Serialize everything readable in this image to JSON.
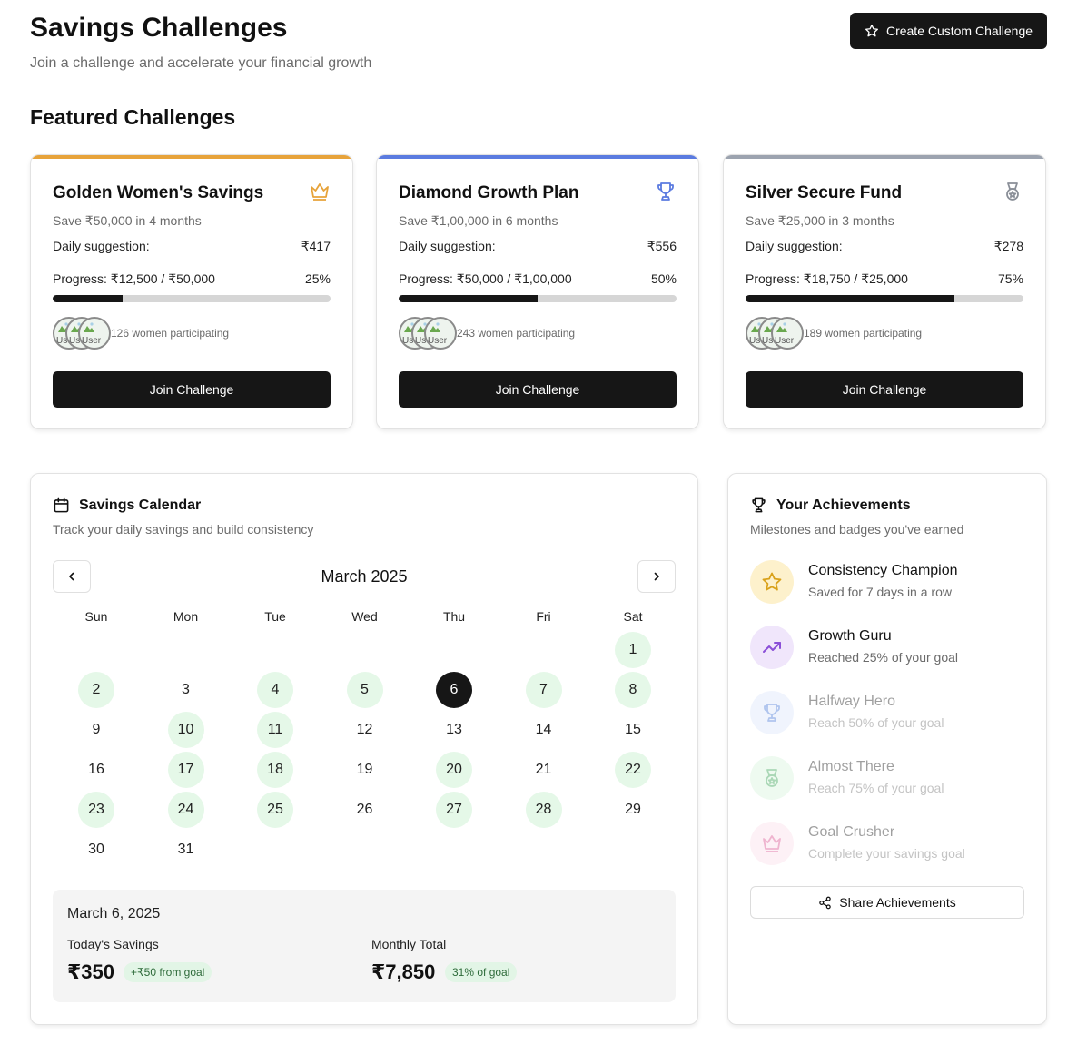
{
  "header": {
    "title": "Savings Challenges",
    "subtitle": "Join a challenge and accelerate your financial growth",
    "create_button": "Create Custom Challenge"
  },
  "featured": {
    "title": "Featured Challenges",
    "cards": [
      {
        "title": "Golden Women's Savings",
        "icon": "crown-icon",
        "accent": "#e7a33a",
        "goal": "Save ₹50,000 in 4 months",
        "daily_label": "Daily suggestion:",
        "daily_value": "₹417",
        "progress_label": "Progress: ₹12,500 / ₹50,000",
        "progress_percent": "25%",
        "progress_fraction": 0.25,
        "avatar_alt": "User",
        "participants": "126 women participating",
        "join": "Join Challenge"
      },
      {
        "title": "Diamond Growth Plan",
        "icon": "trophy-icon",
        "accent": "#5b7be0",
        "goal": "Save ₹1,00,000 in 6 months",
        "daily_label": "Daily suggestion:",
        "daily_value": "₹556",
        "progress_label": "Progress: ₹50,000 / ₹1,00,000",
        "progress_percent": "50%",
        "progress_fraction": 0.5,
        "avatar_alt": "User",
        "participants": "243 women participating",
        "join": "Join Challenge"
      },
      {
        "title": "Silver Secure Fund",
        "icon": "medal-icon",
        "accent": "#9ca3af",
        "goal": "Save ₹25,000 in 3 months",
        "daily_label": "Daily suggestion:",
        "daily_value": "₹278",
        "progress_label": "Progress: ₹18,750 / ₹25,000",
        "progress_percent": "75%",
        "progress_fraction": 0.75,
        "avatar_alt": "User",
        "participants": "189 women participating",
        "join": "Join Challenge"
      }
    ]
  },
  "calendar": {
    "title": "Savings Calendar",
    "subtitle": "Track your daily savings and build consistency",
    "month": "March 2025",
    "weekdays": [
      "Sun",
      "Mon",
      "Tue",
      "Wed",
      "Thu",
      "Fri",
      "Sat"
    ],
    "first_weekday_index": 6,
    "days_in_month": 31,
    "today": 6,
    "saved_days": [
      1,
      2,
      4,
      5,
      7,
      8,
      10,
      11,
      17,
      18,
      20,
      22,
      23,
      24,
      25,
      27,
      28
    ],
    "colors": {
      "saved": "#e5f8e8",
      "today": "#161616"
    },
    "summary": {
      "date": "March 6, 2025",
      "today_label": "Today's Savings",
      "today_value": "₹350",
      "today_badge": "+₹50 from goal",
      "monthly_label": "Monthly Total",
      "monthly_value": "₹7,850",
      "monthly_badge": "31% of goal"
    }
  },
  "achievements": {
    "title": "Your Achievements",
    "subtitle": "Milestones and badges you've earned",
    "items": [
      {
        "title": "Consistency Champion",
        "desc": "Saved for 7 days in a row",
        "icon": "star-icon",
        "earned": true,
        "bg": "#fdf1cc",
        "color": "#d9a21b"
      },
      {
        "title": "Growth Guru",
        "desc": "Reached 25% of your goal",
        "icon": "trending-up-icon",
        "earned": true,
        "bg": "#f0e6fb",
        "color": "#8b4fd8"
      },
      {
        "title": "Halfway Hero",
        "desc": "Reach 50% of your goal",
        "icon": "trophy-icon",
        "earned": false,
        "bg": "#dbe6fb",
        "color": "#3d6fd6"
      },
      {
        "title": "Almost There",
        "desc": "Reach 75% of your goal",
        "icon": "medal-icon",
        "earned": false,
        "bg": "#d6f5dc",
        "color": "#2e9e4a"
      },
      {
        "title": "Goal Crusher",
        "desc": "Complete your savings goal",
        "icon": "crown-icon",
        "earned": false,
        "bg": "#fbdde9",
        "color": "#d9468a"
      }
    ],
    "share": "Share Achievements"
  }
}
